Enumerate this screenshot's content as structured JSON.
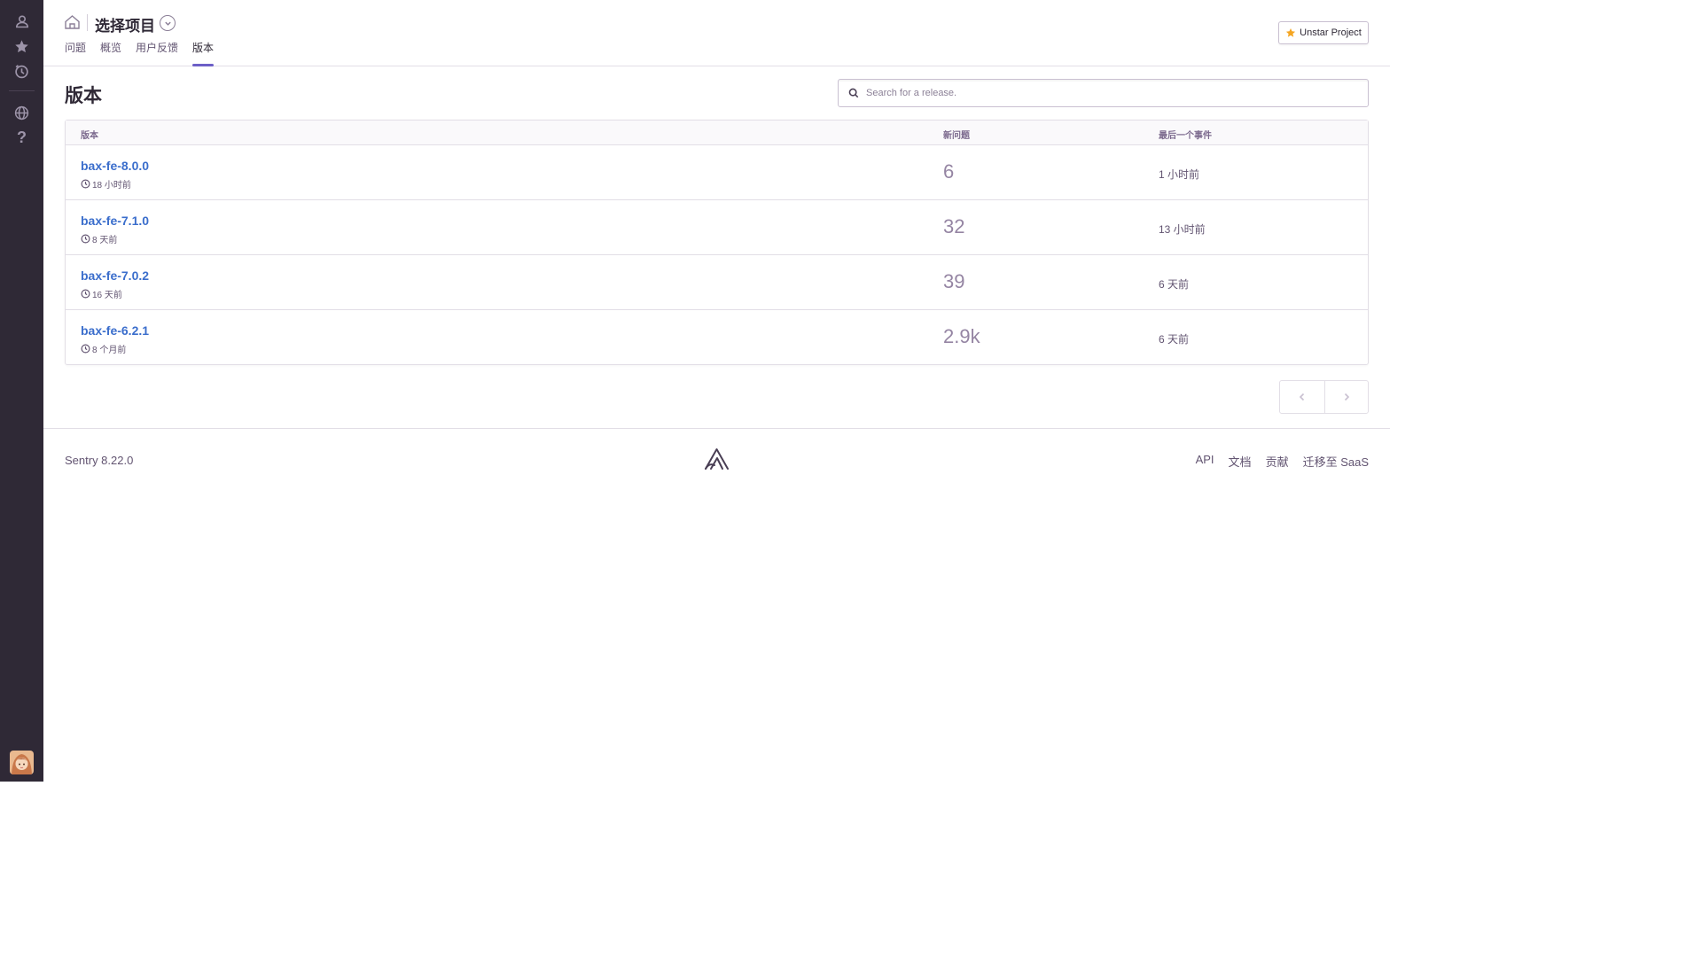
{
  "header": {
    "project_title": "选择项目",
    "tabs": [
      {
        "label": "问题"
      },
      {
        "label": "概览"
      },
      {
        "label": "用户反馈"
      },
      {
        "label": "版本"
      }
    ],
    "active_tab": "版本",
    "star_button_label": "Unstar Project"
  },
  "page": {
    "title": "版本",
    "search_placeholder": "Search for a release."
  },
  "table": {
    "columns": {
      "release": "版本",
      "new_issues": "新问题",
      "last_event": "最后一个事件"
    },
    "rows": [
      {
        "release": "bax-fe-8.0.0",
        "age": "18 小时前",
        "new_issues": "6",
        "last_event": "1 小时前"
      },
      {
        "release": "bax-fe-7.1.0",
        "age": "8 天前",
        "new_issues": "32",
        "last_event": "13 小时前"
      },
      {
        "release": "bax-fe-7.0.2",
        "age": "16 天前",
        "new_issues": "39",
        "last_event": "6 天前"
      },
      {
        "release": "bax-fe-6.2.1",
        "age": "8 个月前",
        "new_issues": "2.9k",
        "last_event": "6 天前"
      }
    ]
  },
  "footer": {
    "version": "Sentry 8.22.0",
    "links": [
      "API",
      "文档",
      "贡献",
      "迁移至 SaaS"
    ]
  },
  "colors": {
    "sidebar_bg": "#2f2936",
    "accent": "#6c5fc7",
    "link": "#3b6ecc",
    "star": "#f5a623"
  },
  "icons": {
    "sidebar": [
      "user-icon",
      "star-icon",
      "clock-icon",
      "globe-icon",
      "help-icon"
    ],
    "header": [
      "home-icon",
      "chevron-down-icon",
      "star-icon"
    ],
    "search": "search-icon",
    "row_age": "clock-icon",
    "pager": [
      "chevron-left-icon",
      "chevron-right-icon"
    ],
    "footer": "sentry-logo-icon"
  }
}
